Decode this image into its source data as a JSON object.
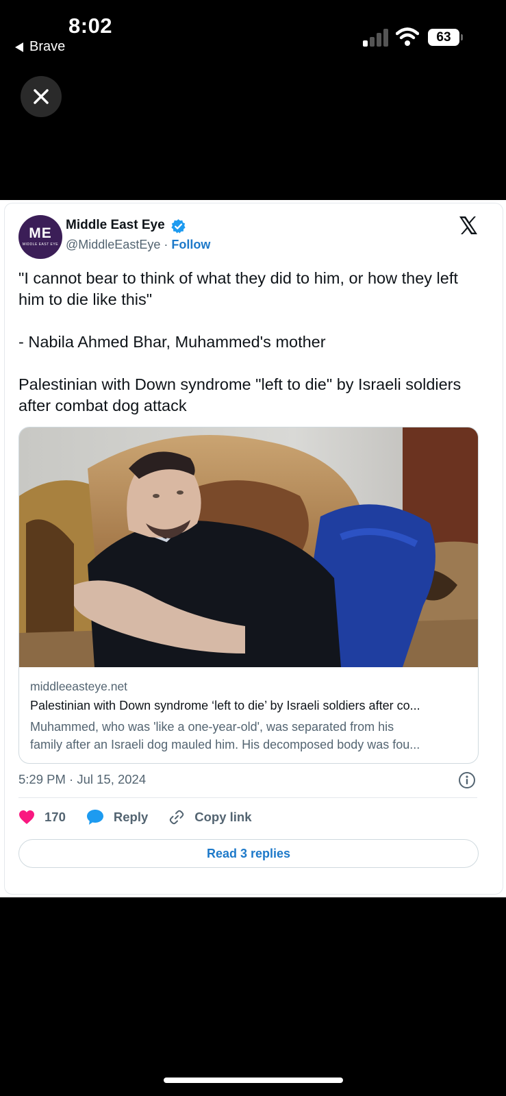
{
  "status_bar": {
    "time": "8:02",
    "back_app": "Brave",
    "battery": "63",
    "signal_bars_filled": 1,
    "signal_bars_total": 4
  },
  "overlay": {
    "close_icon": "close-icon"
  },
  "tweet": {
    "account_name": "Middle East Eye",
    "avatar_text": "ME",
    "avatar_subtext": "MIDDLE EAST EYE",
    "verified": true,
    "handle": "@MiddleEastEye",
    "separator": "·",
    "follow_label": "Follow",
    "platform_icon": "x-logo-icon",
    "text": {
      "quote": "\"I cannot bear to think of what they did to him, or how they left him to die like this\"",
      "attribution": "- Nabila Ahmed Bhar, Muhammed's mother",
      "headline": "Palestinian with Down syndrome \"left to die\" by Israeli soldiers after combat dog attack"
    },
    "link_card": {
      "domain": "middleeasteye.net",
      "title": "Palestinian with Down syndrome ‘left to die’ by Israeli soldiers after co...",
      "description_line1": "Muhammed, who was 'like a one-year-old', was separated from his",
      "description_line2": "family after an Israeli dog mauled him. His decomposed body was fou..."
    },
    "timestamp": "5:29 PM · Jul 15, 2024",
    "actions": {
      "like_count": "170",
      "reply_label": "Reply",
      "copy_link_label": "Copy link"
    },
    "read_replies_label": "Read 3 replies"
  },
  "colors": {
    "accent": "#1d79c9",
    "verified": "#1d9bf0",
    "like": "#f91880",
    "avatar_bg": "#3b1e57",
    "background": "#000000"
  }
}
